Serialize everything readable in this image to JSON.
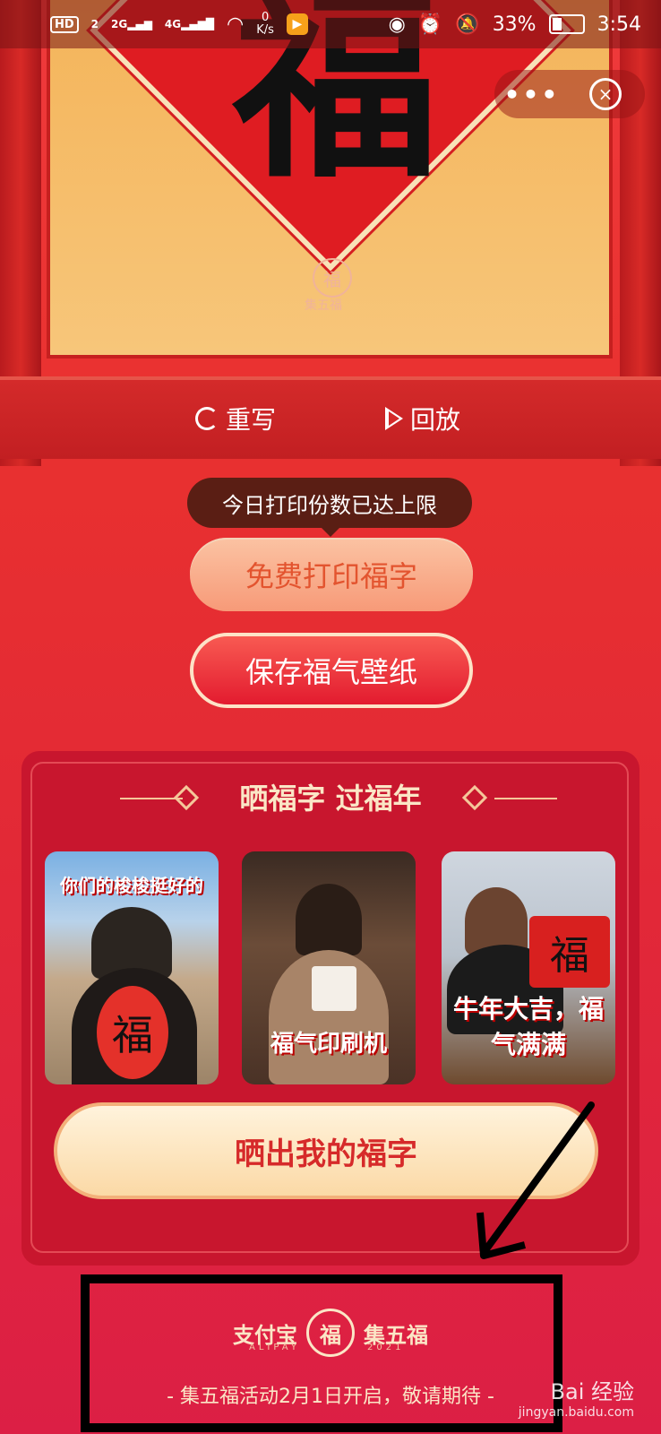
{
  "status_bar": {
    "hd": "HD",
    "sim": "2",
    "net1": "2G",
    "net2": "4G",
    "speed_value": "0",
    "speed_unit": "K/s",
    "battery": "33%",
    "time": "3:54"
  },
  "capsule": {
    "more": "•••",
    "close": "×"
  },
  "banner": {
    "character": "福",
    "seal_char": "福",
    "seal_text": "集五福"
  },
  "controls": {
    "rewrite": "重写",
    "replay": "回放"
  },
  "tooltip": "今日打印份数已达上限",
  "buttons": {
    "print": "免费打印福字",
    "save": "保存福气壁纸",
    "share": "晒出我的福字"
  },
  "share_card": {
    "title": "晒福字 过福年",
    "thumbnails": [
      {
        "caption": "你们的梭梭挺好的",
        "held": "福"
      },
      {
        "caption": "福气印刷机"
      },
      {
        "caption": "牛年大吉，福气满满",
        "held": "福"
      }
    ]
  },
  "footer": {
    "brand_left": "支付宝",
    "brand_left_sub": "ALIPAY",
    "brand_seal": "福",
    "brand_right": "集五福",
    "brand_right_sub": "2021",
    "notice": "- 集五福活动2月1日开启，敬请期待 -"
  },
  "watermark": {
    "main": "Bai 经验",
    "sub": "jingyan.baidu.com"
  },
  "colors": {
    "primary_red": "#e9312f",
    "gold": "#fbe6c6"
  }
}
